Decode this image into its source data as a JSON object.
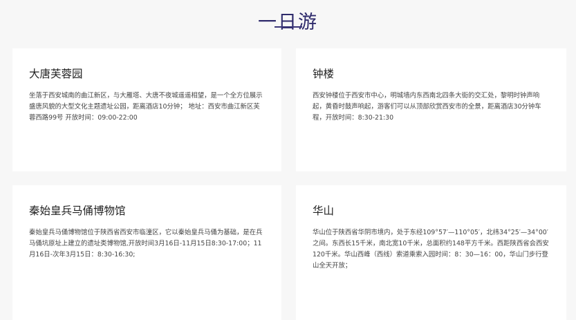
{
  "header": {
    "title": "一日游"
  },
  "cards": [
    {
      "title": "大唐芙蓉园",
      "description": "坐落于西安城南的曲江新区，与大雁塔、大唐不夜城遥遥相望，是一个全方位展示盛唐风貌的大型文化主题遗址公园，距离酒店10分钟； 地址：西安市曲江新区芙蓉西路99号 开放时间：09:00-22:00"
    },
    {
      "title": "钟楼",
      "description": "西安钟楼位于西安市中心，明城墙内东西南北四条大街的交汇处，黎明时钟声响起，黄昏时鼓声响起，游客们可以从顶部欣赏西安市的全景，距离酒店30分钟车程，开放时间：8:30-21:30"
    },
    {
      "title": "秦始皇兵马俑博物馆",
      "description": "秦始皇兵马俑博物馆位于陕西省西安市临潼区，它以秦始皇兵马俑为基础，是在兵马俑坑原址上建立的遗址类博物馆,开放时间3月16日-11月15日8:30-17:00；11月16日-次年3月15日：8:30-16:30;"
    },
    {
      "title": "华山",
      "description": "华山位于陕西省华阴市境内，处于东经109°57′—110°05′，北纬34°25′—34°00′之间。东西长15千米，南北宽10千米，总面积约148平方千米。西距陕西省会西安120千米。华山西峰（西线）索道乘索入园时间：8：30—16：00，华山门步行登山全天开放；"
    }
  ]
}
